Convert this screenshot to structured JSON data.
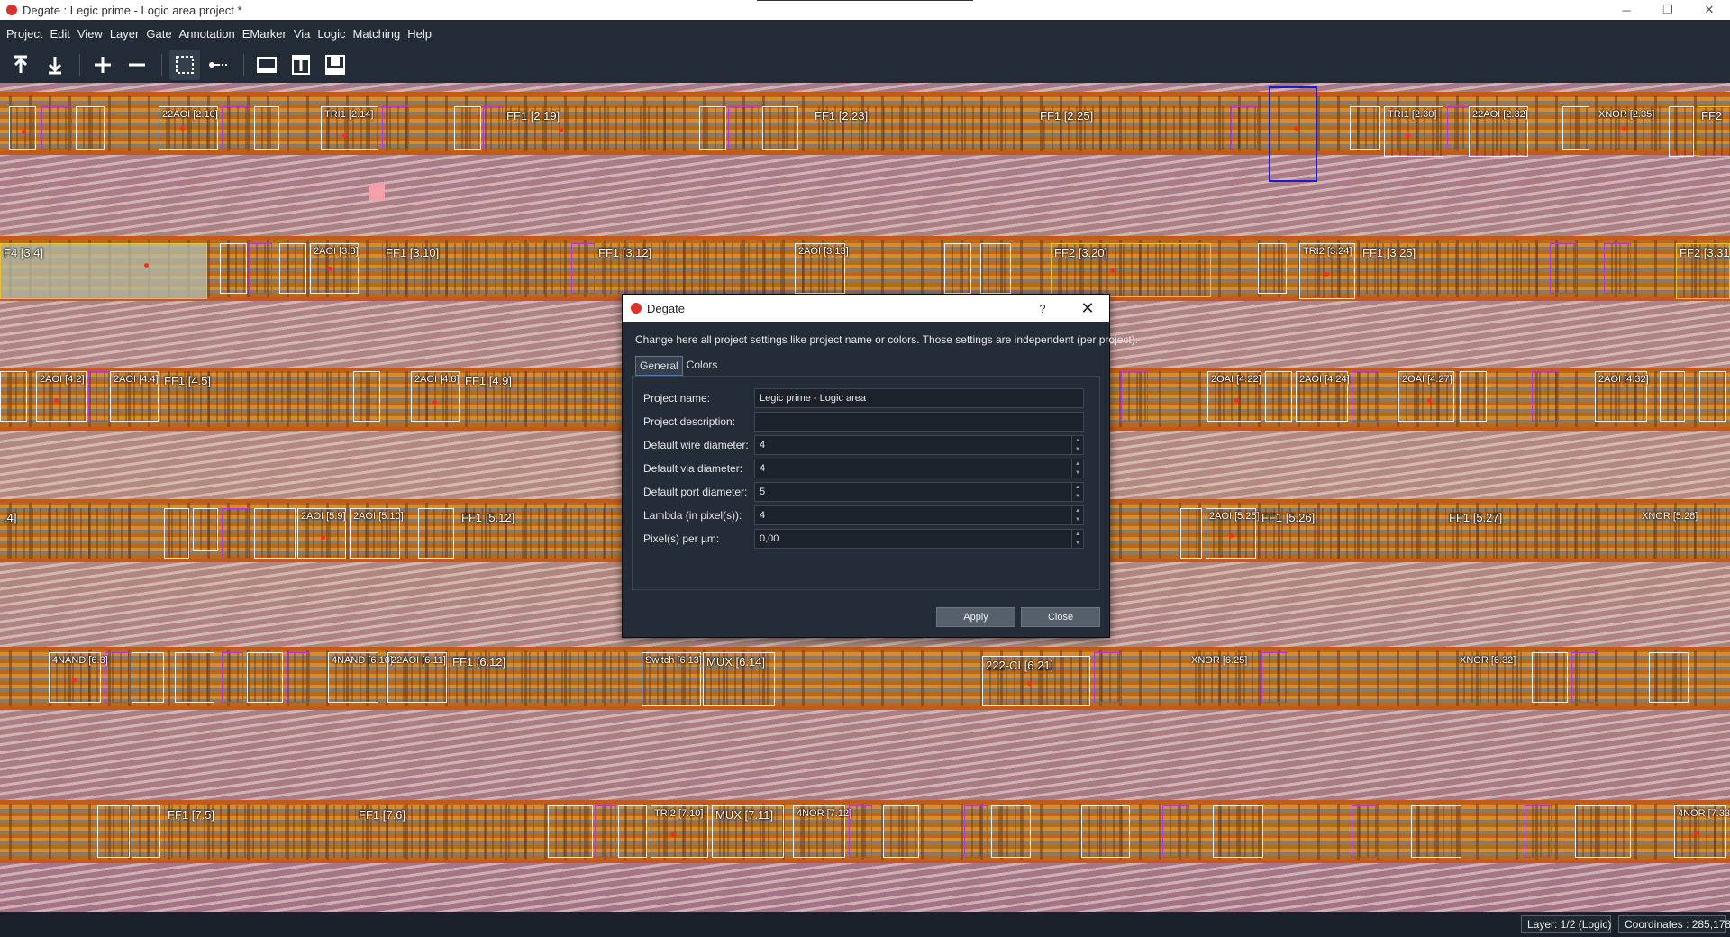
{
  "window": {
    "title": "Degate : Legic prime - Logic area project *",
    "minimize_glyph": "─",
    "maximize_glyph": "❐",
    "close_glyph": "✕"
  },
  "menubar": {
    "items": [
      "Project",
      "Edit",
      "View",
      "Layer",
      "Gate",
      "Annotation",
      "EMarker",
      "Via",
      "Logic",
      "Matching",
      "Help"
    ]
  },
  "toolbar": {
    "tools": [
      "layer-up-icon",
      "layer-down-icon",
      "zoom-in-icon",
      "zoom-out-icon",
      "area-selection-icon",
      "wire-tool-icon",
      "view-top-icon",
      "view-logic-icon",
      "view-bottom-icon"
    ],
    "active_tool": "area-selection-icon"
  },
  "canvas": {
    "gate_labels_row1": [
      "22AOI [2.10]",
      "TRI1 [2.14]",
      "FF1 [2.19]",
      "FF1 [2.23]",
      "FF1 [2.25]",
      "TRI1 [2.30]",
      "22AOI [2.32]",
      "XNOR [2.35]",
      "FF2"
    ],
    "gate_labels_row2": [
      "F4 [3.4]",
      "2AOI [3.8]",
      "FF1 [3.10]",
      "FF1 [3.12]",
      "2AOI [3.13]",
      "FF2 [3.20]",
      "TRI2 [3.24]",
      "FF1 [3.25]",
      "FF2 [3.31"
    ],
    "gate_labels_row3": [
      "2AOI [4.2]",
      "2AOI [4.4]",
      "FF1 [4.5]",
      "2AOI [4.8]",
      "FF1 [4.9]",
      "2OAI [4.22]",
      "2AOI [4.24]",
      "2OAI [4.27]",
      "2AOI [4.32]"
    ],
    "gate_labels_row4": [
      ".4]",
      "2AOI [5.9]",
      "2AOI [5.10]",
      "FF1 [5.12]",
      "2AOI [5.25]",
      "FF1 [5.26]",
      "FF1 [5.27]",
      "XNOR [5.28]"
    ],
    "gate_labels_row5": [
      "4NAND [6.3]",
      "4NAND [6.10]",
      "22AOI [6.11]",
      "FF1 [6.12]",
      "Switch [6.13]",
      "MUX [6.14]",
      "222-CI [6.21]",
      "XNOR [6.25]",
      "XNOR [6.32]"
    ],
    "gate_labels_row6": [
      "FF1 [7.5]",
      "FF1 [7.6]",
      "TRI2 [7.10]",
      "MUX [7.11]",
      "4NOR [7.12]",
      "4NOR [7.33]"
    ]
  },
  "dialog": {
    "title": "Degate",
    "help_label": "?",
    "close_glyph": "✕",
    "description": "Change here all project settings like project name or colors. Those settings are independent (per project).",
    "tabs": [
      {
        "label": "General",
        "active": true
      },
      {
        "label": "Colors",
        "active": false
      }
    ],
    "fields": {
      "project_name": {
        "label": "Project name:",
        "value": "Legic prime - Logic area"
      },
      "project_description": {
        "label": "Project description:",
        "value": ""
      },
      "wire_diameter": {
        "label": "Default wire diameter:",
        "value": "4"
      },
      "via_diameter": {
        "label": "Default via diameter:",
        "value": "4"
      },
      "port_diameter": {
        "label": "Default port diameter:",
        "value": "5"
      },
      "lambda": {
        "label": "Lambda (in pixel(s)):",
        "value": "4"
      },
      "pixels_per_um": {
        "label": "Pixel(s) per µm:",
        "value": "0,00"
      }
    },
    "apply_label": "Apply",
    "close_label": "Close"
  },
  "statusbar": {
    "layer": "Layer: 1/2 (Logic)",
    "coordinates": "Coordinates : 285,178"
  },
  "colors": {
    "selection": "#1a1ad0",
    "gate_border_white": "#ffffff",
    "gate_border_purple": "#b13bd0",
    "gate_border_yellow": "#e6c23a"
  }
}
